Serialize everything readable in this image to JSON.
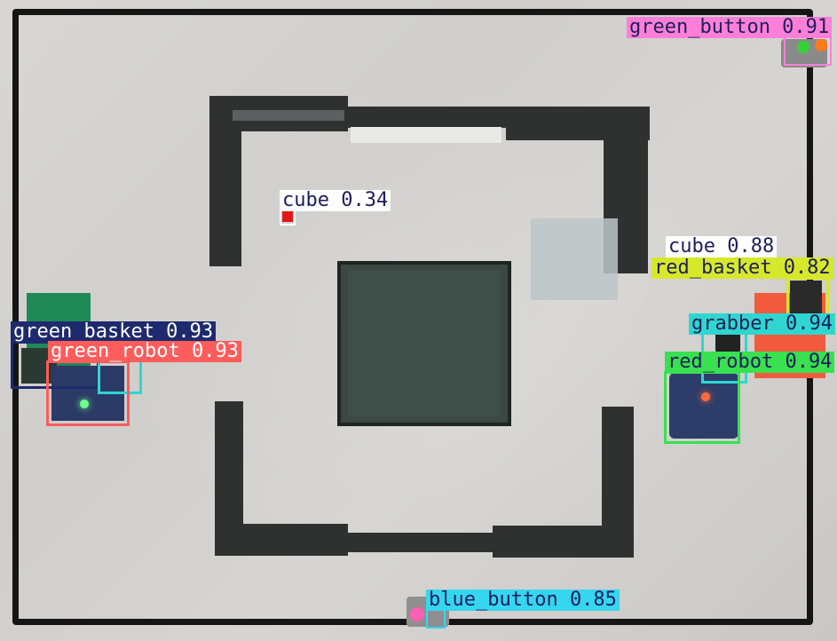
{
  "detections": [
    {
      "id": "green_button",
      "label": "green_button 0.91",
      "color": "#ff7fd8",
      "text": "#1e1e5a"
    },
    {
      "id": "cube_034",
      "label": "cube 0.34",
      "color": "#ffffff",
      "text": "#1e1e5a"
    },
    {
      "id": "cube_088",
      "label": "cube 0.88",
      "color": "#ffffff",
      "text": "#1e1e5a"
    },
    {
      "id": "red_basket",
      "label": "red_basket 0.82",
      "color": "#d6e82a",
      "text": "#1e1e5a"
    },
    {
      "id": "grabber",
      "label": "grabber 0.94",
      "color": "#2fd6d0",
      "text": "#1e1e5a"
    },
    {
      "id": "red_robot",
      "label": "red_robot 0.94",
      "color": "#39e04f",
      "text": "#1e1e5a"
    },
    {
      "id": "green_basket",
      "label": "green_basket 0.93",
      "color": "#1e2a6e",
      "text": "#ffffff"
    },
    {
      "id": "green_robot",
      "label": "green_robot 0.93",
      "color": "#ff5c5c",
      "text": "#ffffff"
    },
    {
      "id": "blue_button",
      "label": "blue_button 0.85",
      "color": "#35d6f0",
      "text": "#1e1e5a"
    }
  ]
}
